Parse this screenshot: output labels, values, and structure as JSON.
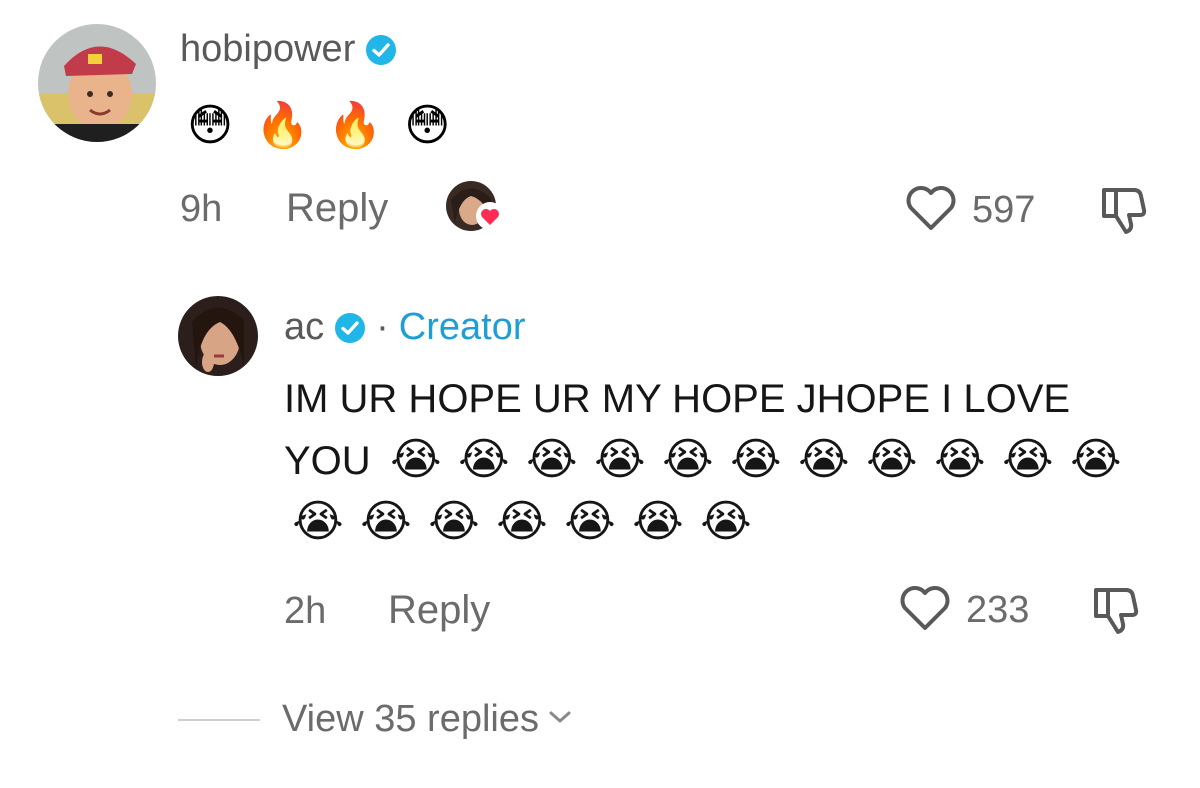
{
  "comment": {
    "username": "hobipower",
    "emojis": [
      "😳",
      "🔥",
      "🔥",
      "😳"
    ],
    "time": "9h",
    "reply_label": "Reply",
    "like_count": "597"
  },
  "reply": {
    "username": "ac",
    "separator": "·",
    "badge": "Creator",
    "text": "IM UR HOPE UR MY HOPE JHOPE I LOVE YOU",
    "emoji": "😭",
    "emoji_count": 18,
    "time": "2h",
    "reply_label": "Reply",
    "like_count": "233"
  },
  "footer": {
    "view_replies_label": "View 35 replies"
  },
  "colors": {
    "verified": "#20b6e8",
    "creator": "#1f9ed6",
    "heart_badge": "#fe2c55"
  },
  "icons": {
    "verified": "verified-check-icon",
    "like": "heart-outline-icon",
    "dislike": "thumbs-down-icon",
    "expand": "chevron-down-icon",
    "liked_by_creator": "heart-badge-icon"
  }
}
